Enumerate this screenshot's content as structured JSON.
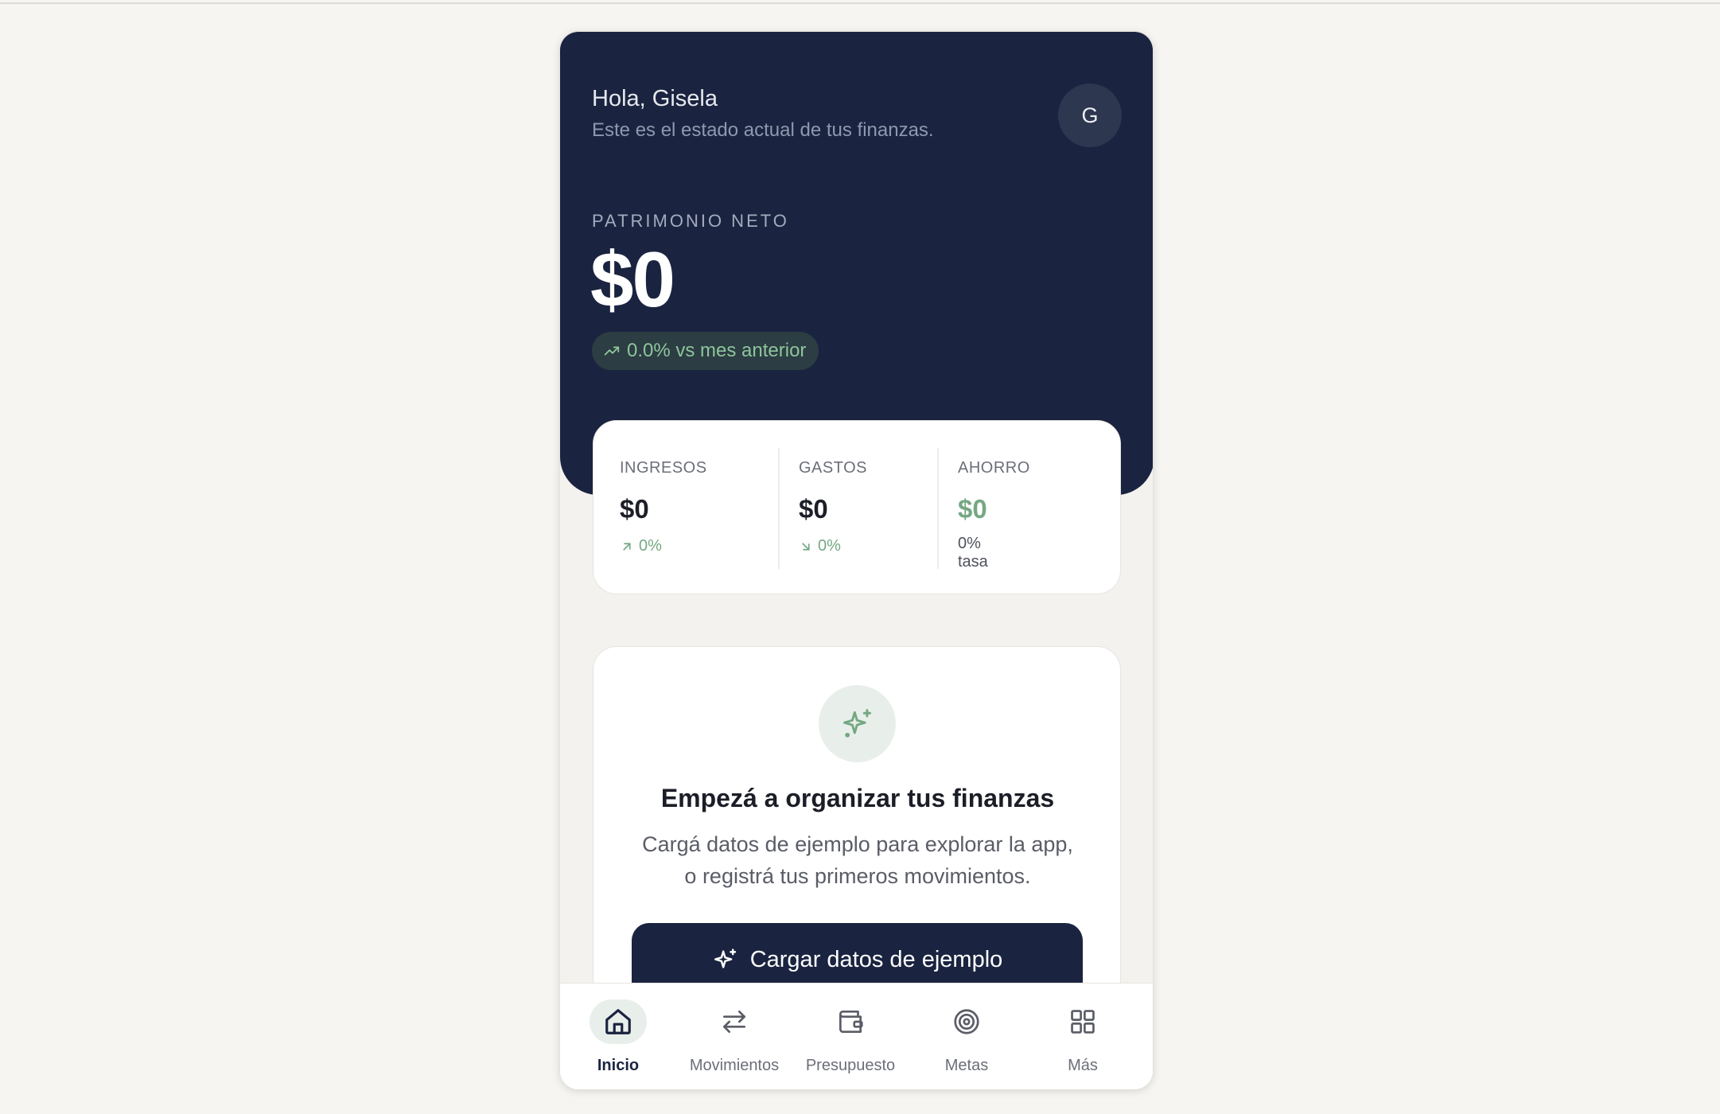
{
  "header": {
    "greeting": "Hola, Gisela",
    "subtitle": "Este es el estado actual de tus finanzas.",
    "avatar_initial": "G"
  },
  "net_worth": {
    "label": "PATRIMONIO NETO",
    "value": "$0",
    "change": "0.0% vs mes anterior"
  },
  "summary": {
    "income": {
      "label": "INGRESOS",
      "value": "$0",
      "change": "0%"
    },
    "expenses": {
      "label": "GASTOS",
      "value": "$0",
      "change": "0%"
    },
    "savings": {
      "label": "AHORRO",
      "value": "$0",
      "note": "0% tasa"
    }
  },
  "empty_state": {
    "title": "Empezá a organizar tus finanzas",
    "description_line1": "Cargá datos de ejemplo para explorar la app,",
    "description_line2": "o registrá tus primeros movimientos.",
    "button_label": "Cargar datos de ejemplo"
  },
  "nav": {
    "items": [
      {
        "label": "Inicio",
        "icon": "home-icon",
        "active": true
      },
      {
        "label": "Movimientos",
        "icon": "transfer-icon"
      },
      {
        "label": "Presupuesto",
        "icon": "wallet-icon"
      },
      {
        "label": "Metas",
        "icon": "target-icon"
      },
      {
        "label": "Más",
        "icon": "grid-icon"
      }
    ]
  },
  "colors": {
    "navy": "#1a2440",
    "accent_green": "#74a883",
    "background": "#f6f5f2"
  }
}
